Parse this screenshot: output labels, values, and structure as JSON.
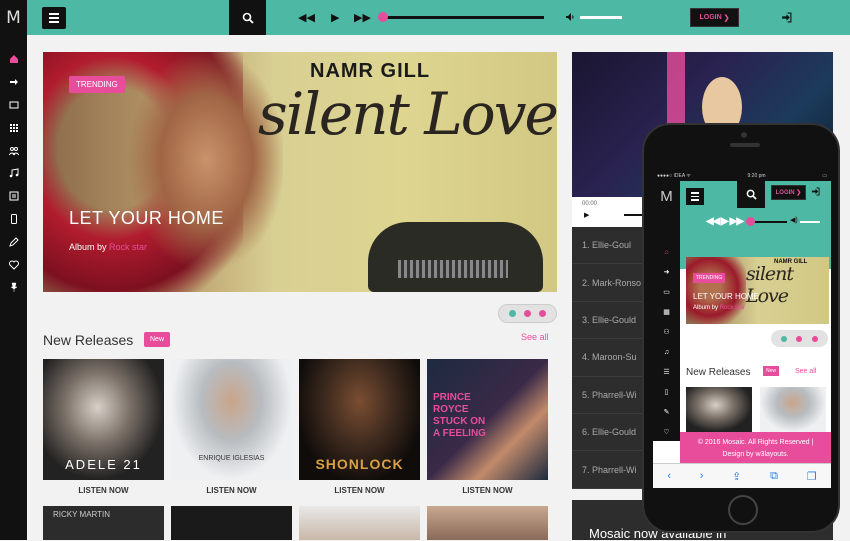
{
  "app": {
    "logo": "M"
  },
  "sidebar": {
    "icons": [
      "home-icon",
      "sign-in-icon",
      "video-icon",
      "grid-icon",
      "users-icon",
      "music-icon",
      "list-icon",
      "mobile-icon",
      "pencil-icon",
      "heart-icon",
      "pin-icon"
    ]
  },
  "topbar": {
    "login_label": "LOGIN",
    "controls": {
      "rewind": "◀◀",
      "play": "▶",
      "forward": "▶▶"
    },
    "volume_icon": "🔈"
  },
  "hero": {
    "tag": "TRENDING",
    "artist": "NAMR GILL",
    "song_art": "silent Love",
    "title": "LET YOUR HOME",
    "sub_prefix": "Album by ",
    "sub_link": "Rock star"
  },
  "new_releases": {
    "title": "New Releases",
    "badge": "New",
    "see_all": "See all",
    "albums": [
      {
        "caption": "ADELE 21",
        "action": "LISTEN NOW",
        "color": "#2c2c2c"
      },
      {
        "caption": "ENRIQUE IGLESIAS",
        "action": "LISTEN NOW",
        "color": "#9ea4a8"
      },
      {
        "caption": "SHONLOCK",
        "action": "LISTEN NOW",
        "color": "#1a1410"
      },
      {
        "caption": "PRINCE ROYCE STUCK ON A FEELING",
        "action": "LISTEN NOW",
        "color": "#1d2a3f"
      }
    ],
    "row2_captions": [
      "RICKY MARTIN"
    ]
  },
  "video": {
    "time": "00:00"
  },
  "playlist": [
    "1. Ellie-Goul",
    "2. Mark-Ronso",
    "3. Ellie-Gould",
    "4. Maroon-Su",
    "5. Pharrell-Wi",
    "6. Ellie-Gould",
    "7. Pharrell-Wi"
  ],
  "mosaic_text": "Mosaic now available in",
  "phone": {
    "status_left": "●●●●○ IDEA ᯤ",
    "status_time": "9:20 pm",
    "status_right": "▭",
    "logo": "M",
    "login_label": "LOGIN",
    "hero_tag": "TRENDING",
    "hero_artist": "NAMR GILL",
    "hero_song": "silent Love",
    "hero_title": "LET YOUR HOME",
    "hero_sub_prefix": "Album by ",
    "hero_sub_link": "Rock star",
    "nr_title": "New Releases",
    "nr_badge": "New",
    "see_all": "See all",
    "footer_line1": "© 2016 Mosaic. All Rights Reserved |",
    "footer_line2": "Design by w3layouts."
  },
  "colors": {
    "teal": "#4db8a3",
    "pink": "#e84d9c",
    "dark": "#111111"
  }
}
